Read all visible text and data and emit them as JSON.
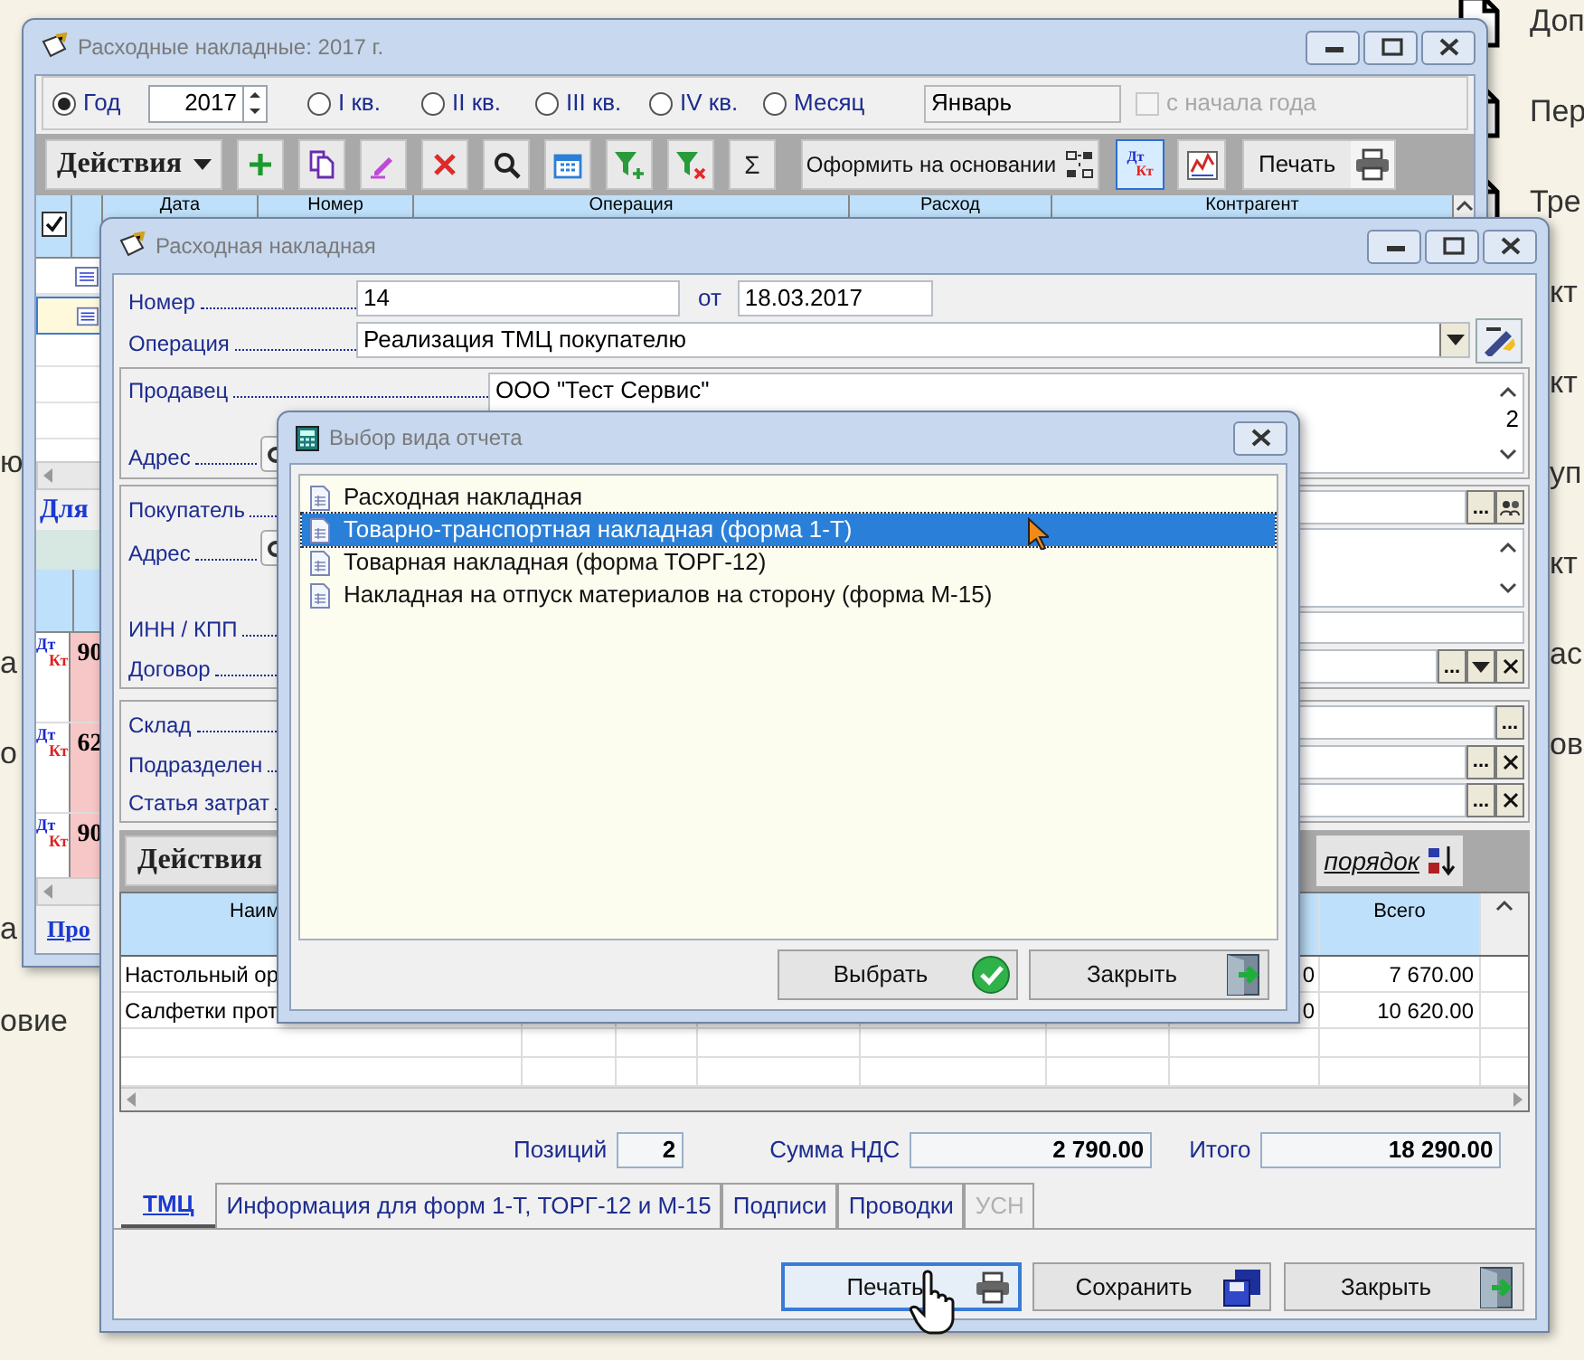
{
  "background": {
    "left_fragments": [
      "ю",
      "а",
      "о",
      "а",
      "овие"
    ],
    "right_items": [
      {
        "kind": "document",
        "text": "Доп"
      },
      {
        "kind": "document",
        "text": "Пер"
      },
      {
        "kind": "document",
        "text": "Тре"
      },
      {
        "kind": "plain",
        "text": "кт"
      },
      {
        "kind": "plain",
        "text": "кт"
      },
      {
        "kind": "plain",
        "text": "уп"
      },
      {
        "kind": "plain",
        "text": "кт"
      },
      {
        "kind": "plain",
        "text": "ас"
      },
      {
        "kind": "plain",
        "text": "ов"
      }
    ]
  },
  "list_window": {
    "title": "Расходные накладные: 2017 г.",
    "periods": [
      {
        "label": "Год",
        "selected": true
      },
      {
        "label": "I кв.",
        "selected": false
      },
      {
        "label": "II кв.",
        "selected": false
      },
      {
        "label": "III кв.",
        "selected": false
      },
      {
        "label": "IV кв.",
        "selected": false
      },
      {
        "label": "Месяц",
        "selected": false
      }
    ],
    "year": "2017",
    "month": "Январь",
    "from_year_start": {
      "label": "с начала года",
      "checked": false,
      "disabled": true
    },
    "toolbar": [
      {
        "kind": "actions",
        "text": "Действия",
        "pressed": false
      },
      {
        "kind": "add",
        "pressed": false
      },
      {
        "kind": "copy",
        "pressed": false
      },
      {
        "kind": "edit",
        "pressed": false
      },
      {
        "kind": "delete",
        "pressed": false
      },
      {
        "kind": "search",
        "pressed": false
      },
      {
        "kind": "calendar",
        "pressed": false
      },
      {
        "kind": "filter_add",
        "pressed": false
      },
      {
        "kind": "filter_clear",
        "pressed": false
      },
      {
        "kind": "sum",
        "text": "Σ",
        "pressed": false
      },
      {
        "kind": "base",
        "text": "Оформить на основании",
        "pressed": false
      },
      {
        "kind": "dtkt",
        "debit": "Дт",
        "credit": "Кт",
        "pressed": true
      },
      {
        "kind": "report",
        "pressed": false
      },
      {
        "kind": "print",
        "text": "Печать",
        "pressed": false
      }
    ],
    "select_all_checked": true,
    "columns": [
      "Дата",
      "Номер",
      "Операция",
      "Расход",
      "Контрагент"
    ],
    "rows": [
      {
        "selected": false
      },
      {
        "selected": true
      }
    ],
    "section_title": "Для",
    "postings": [
      {
        "debit": "Дт",
        "credit": "Кт",
        "account": "90"
      },
      {
        "debit": "Дт",
        "credit": "Кт",
        "account": "62"
      },
      {
        "debit": "Дт",
        "credit": "Кт",
        "account": "90"
      }
    ],
    "postings_link": "Про"
  },
  "invoice_window": {
    "title": "Расходная накладная",
    "number": {
      "label": "Номер",
      "value": "14"
    },
    "date": {
      "label": "от",
      "value": "18.03.2017"
    },
    "operation": {
      "label": "Операция",
      "value": "Реализация ТМЦ покупателю"
    },
    "seller": {
      "label": "Продавец",
      "value": "ООО \"Тест Сервис\"",
      "address_tail": "2",
      "address_label": "Адрес"
    },
    "buyer": {
      "label": "Покупатель",
      "address_label": "Адрес"
    },
    "buyer_fields": [
      {
        "label": "ИНН / КПП"
      },
      {
        "label": "Договор",
        "buttons": [
          {
            "kind": "browse",
            "text": "..."
          },
          {
            "kind": "dropdown"
          },
          {
            "kind": "clear"
          }
        ]
      }
    ],
    "buyer_buttons": [
      {
        "kind": "browse",
        "text": "..."
      },
      {
        "kind": "contacts"
      }
    ],
    "storage_fields": [
      {
        "label": "Склад",
        "buttons": [
          {
            "kind": "browse",
            "text": "..."
          }
        ]
      },
      {
        "label": "Подразделен",
        "buttons": [
          {
            "kind": "browse",
            "text": "..."
          },
          {
            "kind": "clear"
          }
        ]
      },
      {
        "label": "Статья затрат",
        "buttons": [
          {
            "kind": "browse",
            "text": "..."
          },
          {
            "kind": "clear"
          }
        ]
      }
    ],
    "items_toolbar": {
      "actions": "Действия",
      "sort_link": "порядок"
    },
    "items_table": {
      "name_column": "Наим",
      "total_column": "Всего",
      "rows": [
        {
          "name": "Настольный ор",
          "column_7": "0",
          "total": "7 670.00"
        },
        {
          "name": "Салфетки прот",
          "column_7": "0",
          "total": "10 620.00"
        }
      ]
    },
    "totals": [
      {
        "label": "Позиций",
        "value": "2"
      },
      {
        "label": "Сумма НДС",
        "value": "2 790.00"
      },
      {
        "label": "Итого",
        "value": "18 290.00"
      }
    ],
    "tabs": [
      {
        "label": "ТМЦ",
        "selected": true,
        "disabled": false
      },
      {
        "label": "Информация для форм 1-Т, ТОРГ-12 и М-15",
        "selected": false,
        "disabled": false
      },
      {
        "label": "Подписи",
        "selected": false,
        "disabled": false
      },
      {
        "label": "Проводки",
        "selected": false,
        "disabled": false
      },
      {
        "label": "УСН",
        "selected": false,
        "disabled": true
      }
    ],
    "buttons": [
      {
        "kind": "print",
        "label": "Печать",
        "focused": true
      },
      {
        "kind": "save",
        "label": "Сохранить",
        "focused": false
      },
      {
        "kind": "close",
        "label": "Закрыть",
        "focused": false
      }
    ]
  },
  "report_dialog": {
    "title": "Выбор вида отчета",
    "items": [
      {
        "label": "Расходная накладная",
        "selected": false
      },
      {
        "label": "Товарно-транспортная накладная (форма 1-Т)",
        "selected": true
      },
      {
        "label": "Товарная накладная (форма ТОРГ-12)",
        "selected": false
      },
      {
        "label": "Накладная на отпуск материалов на сторону (форма М-15)",
        "selected": false
      }
    ],
    "buttons": [
      {
        "kind": "choose",
        "label": "Выбрать"
      },
      {
        "kind": "close",
        "label": "Закрыть"
      }
    ]
  }
}
